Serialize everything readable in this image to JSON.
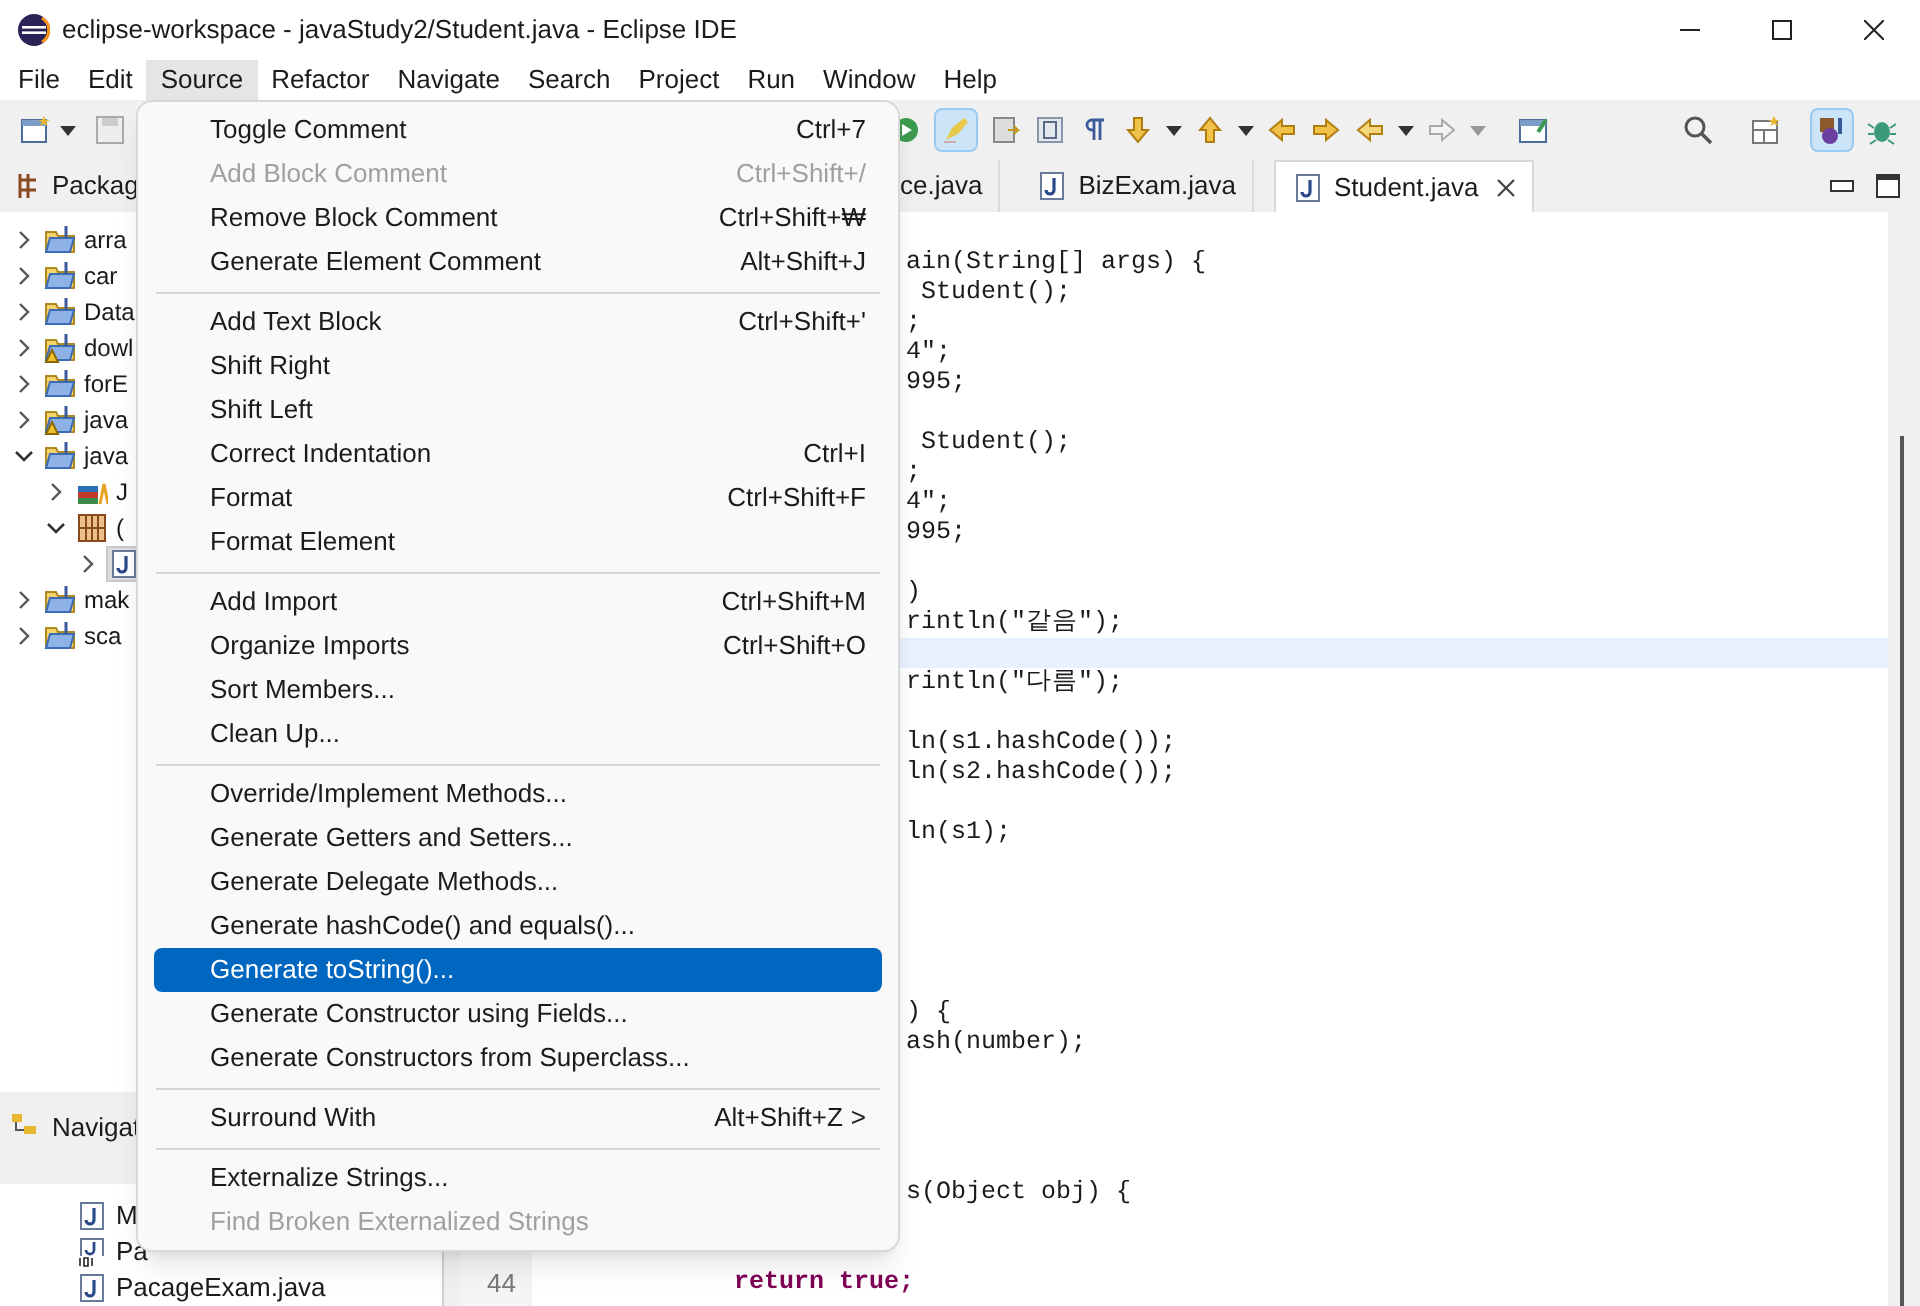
{
  "window": {
    "title": "eclipse-workspace - javaStudy2/Student.java - Eclipse IDE"
  },
  "menubar": [
    {
      "label": "File",
      "selected": false
    },
    {
      "label": "Edit",
      "selected": false
    },
    {
      "label": "Source",
      "selected": true
    },
    {
      "label": "Refactor",
      "selected": false
    },
    {
      "label": "Navigate",
      "selected": false
    },
    {
      "label": "Search",
      "selected": false
    },
    {
      "label": "Project",
      "selected": false
    },
    {
      "label": "Run",
      "selected": false
    },
    {
      "label": "Window",
      "selected": false
    },
    {
      "label": "Help",
      "selected": false
    }
  ],
  "package_explorer": {
    "title": "Packag",
    "tree": [
      {
        "label": "arra",
        "kind": "project",
        "expanded": false,
        "selected": false
      },
      {
        "label": "car",
        "kind": "project",
        "expanded": false,
        "selected": false
      },
      {
        "label": "Data",
        "kind": "project",
        "expanded": false,
        "selected": false
      },
      {
        "label": "dowl",
        "kind": "warning-project",
        "expanded": false,
        "selected": false
      },
      {
        "label": "forE",
        "kind": "project",
        "expanded": false,
        "selected": false
      },
      {
        "label": "java",
        "kind": "warning-project",
        "expanded": false,
        "selected": false
      },
      {
        "label": "java",
        "kind": "project",
        "expanded": true,
        "selected": false,
        "children": [
          {
            "label": "J",
            "kind": "library",
            "expanded": false,
            "selected": false
          },
          {
            "label": "(",
            "kind": "package",
            "expanded": true,
            "selected": false,
            "children": [
              {
                "kind": "java",
                "expanded": false,
                "selected": true
              }
            ]
          }
        ]
      },
      {
        "label": "mak",
        "kind": "project",
        "expanded": false,
        "selected": false
      },
      {
        "label": "sca",
        "kind": "project",
        "expanded": false,
        "selected": false
      }
    ]
  },
  "navigator": {
    "title": "Navigat",
    "items": [
      {
        "label": "M",
        "kind": "java"
      },
      {
        "label": "Pa",
        "kind": "class"
      },
      {
        "label": "PacageExam.java",
        "kind": "java"
      }
    ]
  },
  "editor": {
    "tabs": [
      {
        "label": "ce.java",
        "icon": false,
        "selected": false
      },
      {
        "label": "BizExam.java",
        "icon": true,
        "selected": false
      },
      {
        "label": "Student.java",
        "icon": true,
        "selected": true
      }
    ],
    "fragments": [
      {
        "text": "ain(String[] args) {",
        "current": false
      },
      {
        "text": " Student();",
        "current": false
      },
      {
        "text": ";",
        "current": false
      },
      {
        "text": "4\";",
        "current": false
      },
      {
        "text": "995;",
        "current": false
      },
      {
        "current": false
      },
      {
        "text": " Student();",
        "current": false
      },
      {
        "text": ";",
        "current": false
      },
      {
        "text": "4\";",
        "current": false
      },
      {
        "text": "995;",
        "current": false
      },
      {
        "current": false
      },
      {
        "text": ")",
        "current": false
      },
      {
        "text": "rintln(\"같음\");",
        "current": false
      },
      {
        "current": true
      },
      {
        "text": "rintln(\"다름\");",
        "current": false
      },
      {
        "current": false
      },
      {
        "text": "ln(s1.hashCode());",
        "current": false
      },
      {
        "text": "ln(s2.hashCode());",
        "current": false
      },
      {
        "current": false
      },
      {
        "text": "ln(s1);",
        "current": false
      },
      {
        "current": false
      },
      {
        "current": false
      },
      {
        "current": false
      },
      {
        "current": false
      },
      {
        "current": false
      },
      {
        "text": ") {",
        "current": false
      },
      {
        "text": "ash(number);",
        "current": false
      },
      {
        "current": false
      },
      {
        "current": false
      },
      {
        "current": false
      },
      {
        "current": false
      },
      {
        "text": "s(Object obj) {",
        "current": false
      }
    ],
    "lines": [
      {
        "number": "44",
        "text": "return true;",
        "kind": "keyword"
      }
    ]
  },
  "source_menu": [
    {
      "kind": "item",
      "label": "Toggle Comment",
      "shortcut": "Ctrl+7",
      "disabled": false,
      "selected": false
    },
    {
      "kind": "item",
      "label": "Add Block Comment",
      "shortcut": "Ctrl+Shift+/",
      "disabled": true,
      "selected": false
    },
    {
      "kind": "item",
      "label": "Remove Block Comment",
      "shortcut": "Ctrl+Shift+₩",
      "disabled": false,
      "selected": false
    },
    {
      "kind": "item",
      "label": "Generate Element Comment",
      "shortcut": "Alt+Shift+J",
      "disabled": false,
      "selected": false
    },
    {
      "kind": "separator"
    },
    {
      "kind": "item",
      "label": "Add Text Block",
      "shortcut": "Ctrl+Shift+'",
      "disabled": false,
      "selected": false
    },
    {
      "kind": "item",
      "label": "Shift Right",
      "disabled": false,
      "selected": false
    },
    {
      "kind": "item",
      "label": "Shift Left",
      "disabled": false,
      "selected": false
    },
    {
      "kind": "item",
      "label": "Correct Indentation",
      "shortcut": "Ctrl+I",
      "disabled": false,
      "selected": false
    },
    {
      "kind": "item",
      "label": "Format",
      "shortcut": "Ctrl+Shift+F",
      "disabled": false,
      "selected": false
    },
    {
      "kind": "item",
      "label": "Format Element",
      "disabled": false,
      "selected": false
    },
    {
      "kind": "separator"
    },
    {
      "kind": "item",
      "label": "Add Import",
      "shortcut": "Ctrl+Shift+M",
      "disabled": false,
      "selected": false
    },
    {
      "kind": "item",
      "label": "Organize Imports",
      "shortcut": "Ctrl+Shift+O",
      "disabled": false,
      "selected": false
    },
    {
      "kind": "item",
      "label": "Sort Members...",
      "disabled": false,
      "selected": false
    },
    {
      "kind": "item",
      "label": "Clean Up...",
      "disabled": false,
      "selected": false
    },
    {
      "kind": "separator"
    },
    {
      "kind": "item",
      "label": "Override/Implement Methods...",
      "disabled": false,
      "selected": false
    },
    {
      "kind": "item",
      "label": "Generate Getters and Setters...",
      "disabled": false,
      "selected": false
    },
    {
      "kind": "item",
      "label": "Generate Delegate Methods...",
      "disabled": false,
      "selected": false
    },
    {
      "kind": "item",
      "label": "Generate hashCode() and equals()...",
      "disabled": false,
      "selected": false
    },
    {
      "kind": "item",
      "label": "Generate toString()...",
      "disabled": false,
      "selected": true
    },
    {
      "kind": "item",
      "label": "Generate Constructor using Fields...",
      "disabled": false,
      "selected": false
    },
    {
      "kind": "item",
      "label": "Generate Constructors from Superclass...",
      "disabled": false,
      "selected": false
    },
    {
      "kind": "separator"
    },
    {
      "kind": "item",
      "label": "Surround With",
      "shortcut": "Alt+Shift+Z",
      "arrow": ">",
      "disabled": false,
      "selected": false
    },
    {
      "kind": "separator"
    },
    {
      "kind": "item",
      "label": "Externalize Strings...",
      "disabled": false,
      "selected": false
    },
    {
      "kind": "item",
      "label": "Find Broken Externalized Strings",
      "disabled": true,
      "selected": false
    }
  ]
}
